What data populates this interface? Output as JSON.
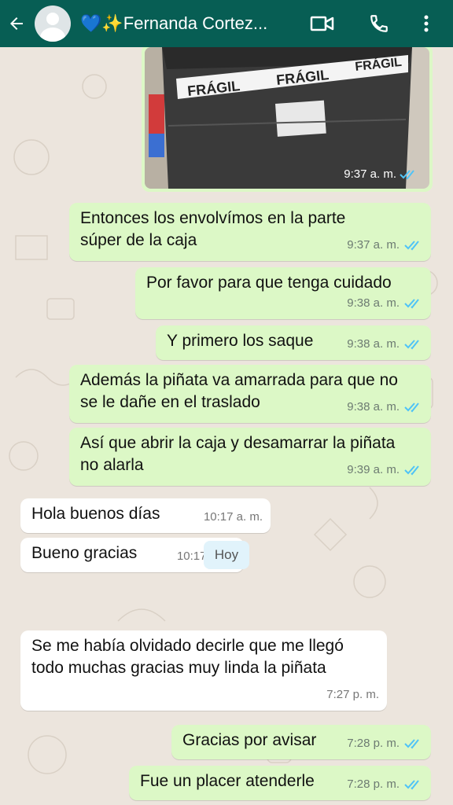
{
  "header": {
    "contact_name": "💙✨Fernanda Cortez...",
    "bg_color": "#075E54",
    "icons": [
      "back-arrow-icon",
      "video-call-icon",
      "phone-icon",
      "more-options-icon"
    ]
  },
  "image_message": {
    "photo_text": [
      "FRÁGIL",
      "FRÁGIL",
      "FRÁGIL"
    ],
    "time": "9:37 a. m."
  },
  "messages": [
    {
      "id": "m1",
      "dir": "out",
      "text": "Entonces los envolvímos en la parte súper de la caja",
      "time": "9:37 a. m."
    },
    {
      "id": "m2",
      "dir": "out",
      "text": "Por favor para que tenga cuidado",
      "time": "9:38 a. m."
    },
    {
      "id": "m3",
      "dir": "out",
      "text": "Y primero los saque",
      "time": "9:38 a. m."
    },
    {
      "id": "m4",
      "dir": "out",
      "text": "Además la piñata va amarrada para que no se le dañe en el traslado",
      "time": "9:38 a. m."
    },
    {
      "id": "m5",
      "dir": "out",
      "text": "Así que abrir la caja y desamarrar la piñata no alarla",
      "time": "9:39 a. m."
    },
    {
      "id": "m6",
      "dir": "in",
      "text": "Hola buenos días",
      "time": "10:17 a. m."
    },
    {
      "id": "m7",
      "dir": "in",
      "text": "Bueno gracias",
      "time": "10:17 a. m."
    },
    {
      "id": "m8",
      "dir": "in",
      "text": "Se me había olvidado decirle que me llegó todo muchas gracias muy linda la piñata",
      "time": "7:27 p. m."
    },
    {
      "id": "m9",
      "dir": "out",
      "text": "Gracias por avisar",
      "time": "7:28 p. m."
    },
    {
      "id": "m10",
      "dir": "out",
      "text": "Fue un placer atenderle",
      "time": "7:28 p. m."
    }
  ],
  "date_divider": "Hoy",
  "colors": {
    "outgoing": "#DCF8C6",
    "incoming": "#FFFFFF",
    "read_ticks": "#4FC3F7",
    "chat_bg": "#ECE5DD"
  }
}
